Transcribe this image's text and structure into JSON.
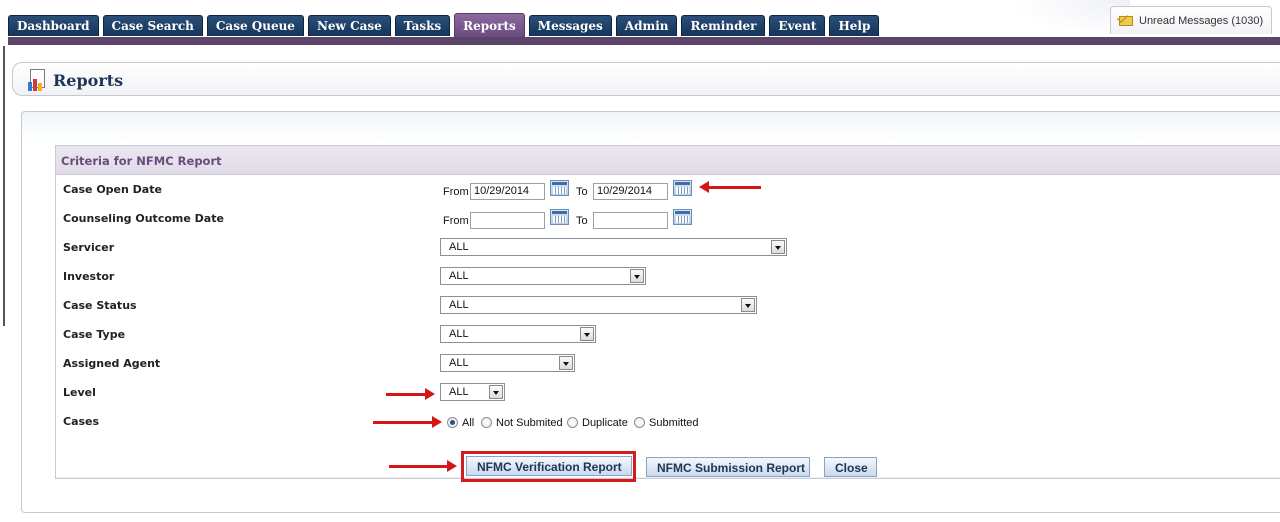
{
  "nav": {
    "tabs": [
      {
        "label": "Dashboard"
      },
      {
        "label": "Case Search"
      },
      {
        "label": "Case Queue"
      },
      {
        "label": "New Case"
      },
      {
        "label": "Tasks"
      },
      {
        "label": "Reports"
      },
      {
        "label": "Messages"
      },
      {
        "label": "Admin"
      },
      {
        "label": "Reminder"
      },
      {
        "label": "Event"
      },
      {
        "label": "Help"
      }
    ],
    "active_tab": "Reports",
    "unread_messages": "Unread Messages (1030)"
  },
  "page": {
    "title": "Reports",
    "icon": "report-chart-icon"
  },
  "criteria": {
    "title": "Criteria for NFMC Report",
    "case_open_date": {
      "label": "Case Open Date",
      "from_label": "From",
      "from_value": "10/29/2014",
      "to_label": "To",
      "to_value": "10/29/2014"
    },
    "counseling_outcome_date": {
      "label": "Counseling Outcome Date",
      "from_label": "From",
      "from_value": "",
      "to_label": "To",
      "to_value": ""
    },
    "servicer": {
      "label": "Servicer",
      "value": "ALL"
    },
    "investor": {
      "label": "Investor",
      "value": "ALL"
    },
    "case_status": {
      "label": "Case Status",
      "value": "ALL"
    },
    "case_type": {
      "label": "Case Type",
      "value": "ALL"
    },
    "assigned_agent": {
      "label": "Assigned Agent",
      "value": "ALL"
    },
    "level": {
      "label": "Level",
      "value": "ALL"
    },
    "cases": {
      "label": "Cases",
      "options": [
        {
          "label": "All",
          "selected": true
        },
        {
          "label": "Not Submited",
          "selected": false
        },
        {
          "label": "Duplicate",
          "selected": false
        },
        {
          "label": "Submitted",
          "selected": false
        }
      ]
    }
  },
  "buttons": {
    "verification": "NFMC Verification Report",
    "submission": "NFMC Submission Report",
    "close": "Close"
  },
  "colors": {
    "nav_tab": "#1f4068",
    "active_tab": "#7b5a8f",
    "nav_line": "#5d4569",
    "criteria_title": "#6a4a7f",
    "annotation_red": "#d41616"
  }
}
